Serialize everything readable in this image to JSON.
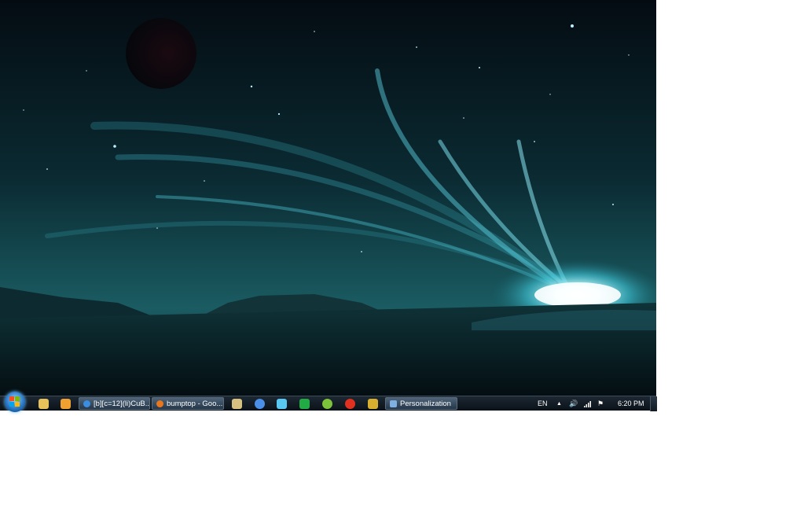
{
  "taskbar": {
    "quick_launch": [
      {
        "name": "explorer-folder-icon",
        "color": "#e7c15a"
      },
      {
        "name": "media-player-icon",
        "color": "#f0a030"
      }
    ],
    "windows": [
      {
        "label": "[b][c=12](li)CuB...",
        "icon": "messenger-icon",
        "color": "#3a8de0"
      },
      {
        "label": "bumptop - Goo...",
        "icon": "firefox-icon",
        "color": "#e8761d"
      },
      {
        "label": "Personalization",
        "icon": "control-panel-icon",
        "color": "#7fb0e0"
      }
    ],
    "pinned": [
      {
        "name": "folder-icon",
        "color": "#d8c080"
      },
      {
        "name": "safari-compass-icon",
        "color": "#4a8fe8"
      },
      {
        "name": "feather-app-icon",
        "color": "#58c8f0"
      },
      {
        "name": "green-app-icon",
        "color": "#22aa44"
      },
      {
        "name": "utorrent-icon",
        "color": "#7cc23a"
      },
      {
        "name": "red-app-icon",
        "color": "#e03020"
      },
      {
        "name": "rocket-app-icon",
        "color": "#d8b030"
      }
    ],
    "tray": {
      "language": "EN",
      "clock": "6:20 PM"
    }
  }
}
